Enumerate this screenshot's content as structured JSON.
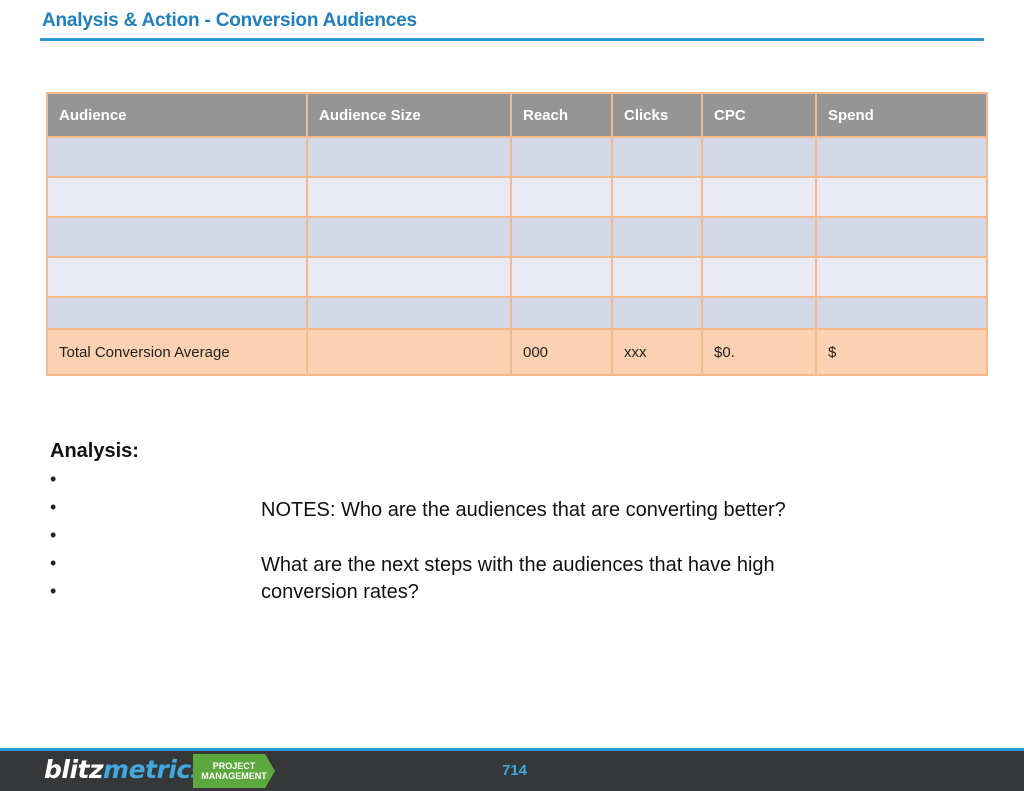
{
  "slide": {
    "title": "Analysis & Action - Conversion Audiences"
  },
  "table": {
    "headers": [
      "Audience",
      "Audience Size",
      "Reach",
      "Clicks",
      "CPC",
      "Spend"
    ],
    "rows": [
      [
        "",
        "",
        "",
        "",
        "",
        ""
      ],
      [
        "",
        "",
        "",
        "",
        "",
        ""
      ],
      [
        "",
        "",
        "",
        "",
        "",
        ""
      ],
      [
        "",
        "",
        "",
        "",
        "",
        ""
      ],
      [
        "",
        "",
        "",
        "",
        "",
        ""
      ]
    ],
    "total": [
      "Total Conversion Average",
      "",
      "000",
      "xxx",
      "$0.",
      "$"
    ]
  },
  "analysis": {
    "heading": "Analysis:",
    "bullets": [
      "",
      "",
      "",
      "",
      ""
    ]
  },
  "notes": {
    "paragraph1": "NOTES: Who are the audiences that are converting better?",
    "paragraph2": "What are the next steps with the audiences that have high conversion rates?"
  },
  "footer": {
    "logo_part1": "blitz",
    "logo_part2": "metrics",
    "badge_line1": "PROJECT",
    "badge_line2": "MANAGEMENT",
    "page_number": "714"
  },
  "colors": {
    "title_blue": "#1f7fbf",
    "header_gray": "#959595",
    "row_band_dark": "#d3d7e6",
    "row_band_light": "#e8e9f2",
    "total_row_peach": "#fbd1b2",
    "border_orange": "#f6b98a",
    "footer_dark": "#363738",
    "badge_green": "#5da83e"
  }
}
